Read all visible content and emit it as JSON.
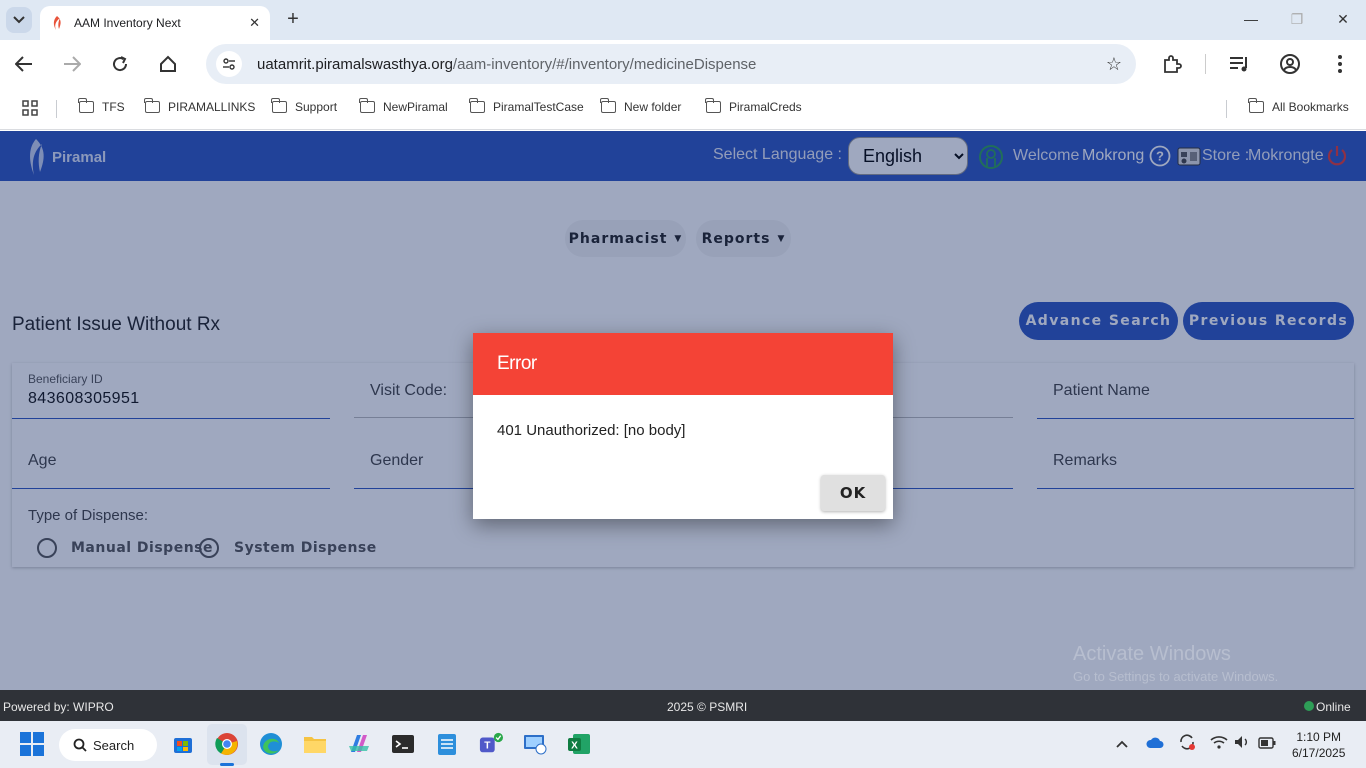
{
  "browser": {
    "tab_title": "AAM Inventory Next",
    "url_host": "uatamrit.piramalswasthya.org",
    "url_path": "/aam-inventory/#/inventory/medicineDispense",
    "bookmarks": [
      {
        "label": "TFS"
      },
      {
        "label": "PIRAMALLINKS"
      },
      {
        "label": "Support"
      },
      {
        "label": "NewPiramal"
      },
      {
        "label": "PiramalTestCase"
      },
      {
        "label": "New folder"
      },
      {
        "label": "PiramalCreds"
      }
    ],
    "all_bookmarks_label": "All Bookmarks"
  },
  "header": {
    "logo_text": "Piramal",
    "select_language_label": "Select Language :",
    "language_value": "English",
    "welcome_label": "Welcome",
    "user_name": "Mokrong",
    "store_label": "Store :",
    "store_name": "Mokrongte",
    "brand_color": "#2d55c0"
  },
  "nav": {
    "pharmacist_label": "Pharmacist",
    "reports_label": "Reports"
  },
  "page": {
    "title": "Patient Issue Without Rx",
    "advance_search_label": "Advance Search",
    "previous_records_label": "Previous Records"
  },
  "form": {
    "beneficiary_id_label": "Beneficiary ID",
    "beneficiary_id_value": "843608305951",
    "visit_code_placeholder": "Visit Code:",
    "patient_name_placeholder": "Patient Name",
    "age_placeholder": "Age",
    "gender_placeholder": "Gender",
    "remarks_placeholder": "Remarks",
    "dispense_type_label": "Type of Dispense:",
    "manual_dispense_label": "Manual Dispense",
    "system_dispense_label": "System Dispense"
  },
  "dialog": {
    "title": "Error",
    "message": "401 Unauthorized: [no body]",
    "ok_label": "OK",
    "header_color": "#f44336"
  },
  "watermark": {
    "line1": "Activate Windows",
    "line2": "Go to Settings to activate Windows."
  },
  "footer": {
    "powered_by": "Powered by: WIPRO",
    "copyright": "2025 © PSMRI",
    "status": "Online"
  },
  "taskbar": {
    "search_label": "Search",
    "time": "1:10 PM",
    "date": "6/17/2025"
  }
}
